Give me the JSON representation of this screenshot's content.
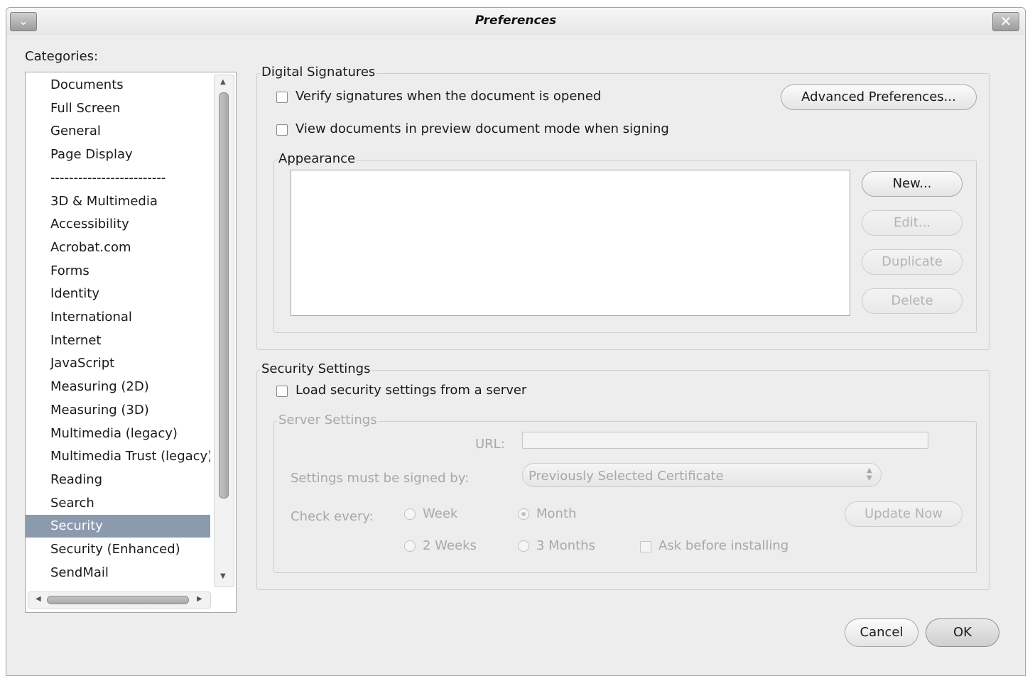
{
  "window": {
    "title": "Preferences",
    "menu_icon": "chevron-down-icon",
    "close_icon": "close-icon"
  },
  "categories": {
    "label": "Categories:",
    "items": [
      {
        "label": "Documents",
        "selected": false
      },
      {
        "label": "Full Screen",
        "selected": false
      },
      {
        "label": "General",
        "selected": false
      },
      {
        "label": "Page Display",
        "selected": false
      },
      {
        "label": "-------------------------",
        "selected": false
      },
      {
        "label": "3D & Multimedia",
        "selected": false
      },
      {
        "label": "Accessibility",
        "selected": false
      },
      {
        "label": "Acrobat.com",
        "selected": false
      },
      {
        "label": "Forms",
        "selected": false
      },
      {
        "label": "Identity",
        "selected": false
      },
      {
        "label": "International",
        "selected": false
      },
      {
        "label": "Internet",
        "selected": false
      },
      {
        "label": "JavaScript",
        "selected": false
      },
      {
        "label": "Measuring (2D)",
        "selected": false
      },
      {
        "label": "Measuring (3D)",
        "selected": false
      },
      {
        "label": "Multimedia (legacy)",
        "selected": false
      },
      {
        "label": "Multimedia Trust (legacy)",
        "selected": false
      },
      {
        "label": "Reading",
        "selected": false
      },
      {
        "label": "Search",
        "selected": false
      },
      {
        "label": "Security",
        "selected": true
      },
      {
        "label": "Security (Enhanced)",
        "selected": false
      },
      {
        "label": "SendMail",
        "selected": false
      }
    ]
  },
  "digital_signatures": {
    "title": "Digital Signatures",
    "verify_checkbox": {
      "label": "Verify signatures when the document is opened",
      "checked": false
    },
    "preview_checkbox": {
      "label": "View documents in preview document mode when signing",
      "checked": false
    },
    "advanced_button": "Advanced Preferences...",
    "appearance": {
      "title": "Appearance",
      "new_button": "New...",
      "edit_button": "Edit...",
      "duplicate_button": "Duplicate",
      "delete_button": "Delete"
    }
  },
  "security_settings": {
    "title": "Security Settings",
    "load_checkbox": {
      "label": "Load security settings from a server",
      "checked": false
    },
    "server_settings": {
      "title": "Server Settings",
      "url_label": "URL:",
      "url_value": "",
      "signed_by_label": "Settings must be signed by:",
      "signed_by_value": "Previously Selected Certificate",
      "check_every_label": "Check every:",
      "options": {
        "week": {
          "label": "Week",
          "checked": false
        },
        "month": {
          "label": "Month",
          "checked": true
        },
        "two_weeks": {
          "label": "2 Weeks",
          "checked": false
        },
        "three_months": {
          "label": "3 Months",
          "checked": false
        }
      },
      "update_now_button": "Update Now",
      "ask_before_installing": {
        "label": "Ask before installing",
        "checked": false
      }
    }
  },
  "footer": {
    "cancel_button": "Cancel",
    "ok_button": "OK"
  }
}
